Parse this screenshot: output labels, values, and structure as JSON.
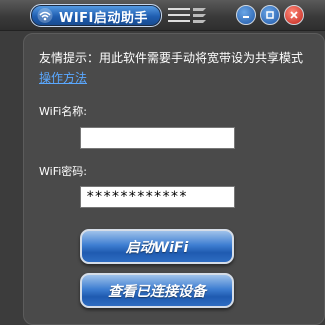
{
  "window": {
    "title": "WIFI启动助手",
    "menu_icon": "menu-icon",
    "controls": {
      "minimize_icon": "minimize-icon",
      "maximize_icon": "maximize-icon",
      "close_icon": "close-icon"
    }
  },
  "main": {
    "tip": "友情提示：用此软件需要手动将宽带设为共享模式",
    "howto_link": "操作方法",
    "wifi_name_label": "WiFi名称:",
    "wifi_name_value": "",
    "wifi_password_label": "WiFi密码:",
    "wifi_password_value": "************",
    "start_button": "启动WiFi",
    "devices_button": "查看已连接设备"
  },
  "colors": {
    "accent": "#2e6cc2",
    "close": "#c0231a",
    "background": "#3c3c3c"
  }
}
